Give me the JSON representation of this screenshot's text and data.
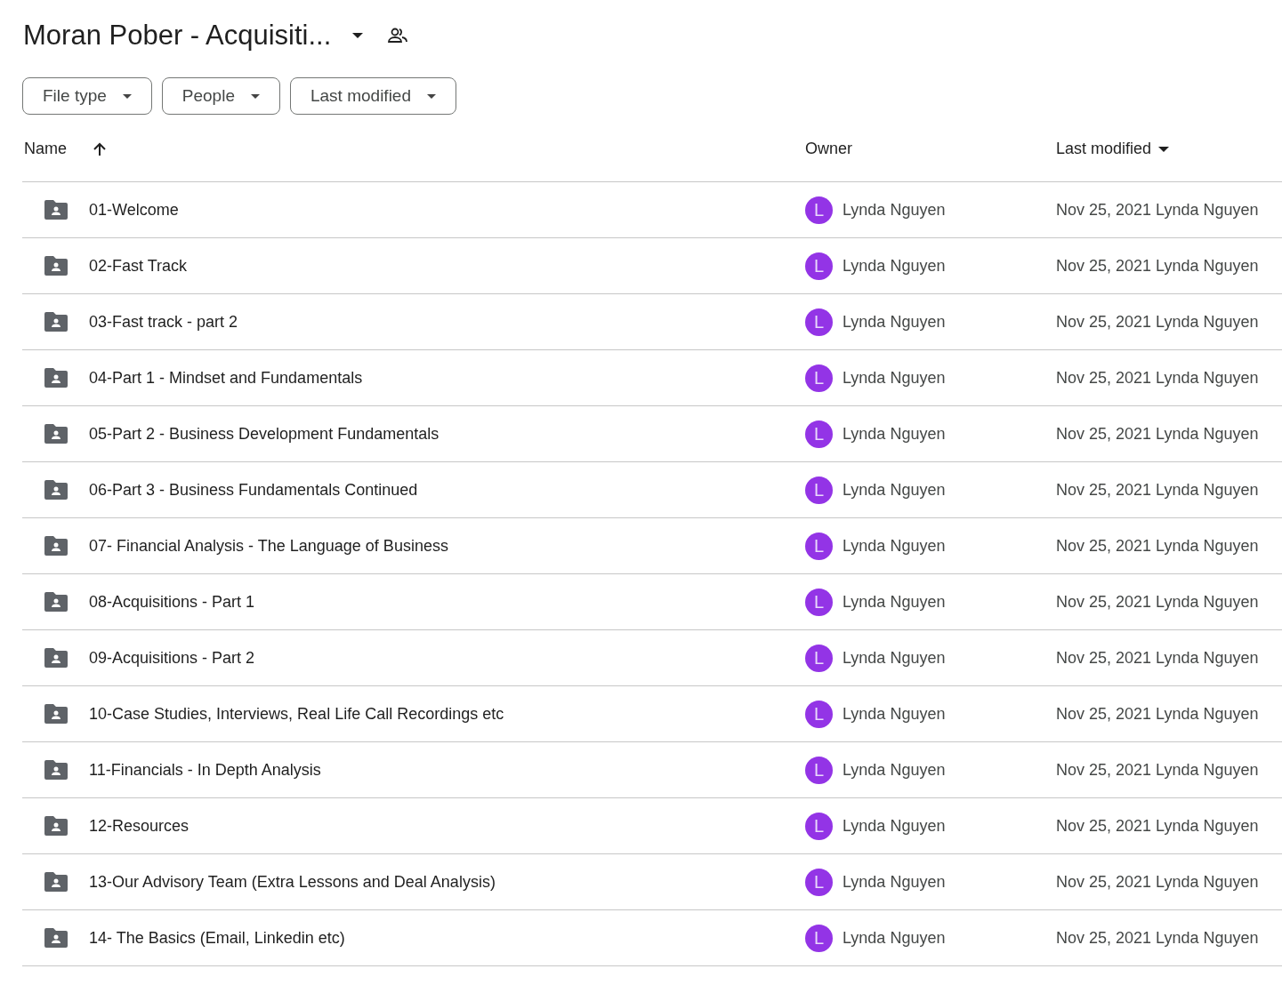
{
  "title": "Moran Pober - Acquisiti...",
  "filters": [
    "File type",
    "People",
    "Last modified"
  ],
  "columns": [
    "Name",
    "Owner",
    "Last modified"
  ],
  "rows": [
    {
      "name": "01-Welcome",
      "avatar": "L",
      "owner": "Lynda Nguyen",
      "modified": "Nov 25, 2021 Lynda Nguyen"
    },
    {
      "name": "02-Fast Track",
      "avatar": "L",
      "owner": "Lynda Nguyen",
      "modified": "Nov 25, 2021 Lynda Nguyen"
    },
    {
      "name": "03-Fast track - part 2",
      "avatar": "L",
      "owner": "Lynda Nguyen",
      "modified": "Nov 25, 2021 Lynda Nguyen"
    },
    {
      "name": "04-Part 1 - Mindset and Fundamentals",
      "avatar": "L",
      "owner": "Lynda Nguyen",
      "modified": "Nov 25, 2021 Lynda Nguyen"
    },
    {
      "name": "05-Part 2 - Business Development Fundamentals",
      "avatar": "L",
      "owner": "Lynda Nguyen",
      "modified": "Nov 25, 2021 Lynda Nguyen"
    },
    {
      "name": "06-Part 3 - Business Fundamentals Continued",
      "avatar": "L",
      "owner": "Lynda Nguyen",
      "modified": "Nov 25, 2021 Lynda Nguyen"
    },
    {
      "name": "07- Financial Analysis - The Language of Business",
      "avatar": "L",
      "owner": "Lynda Nguyen",
      "modified": "Nov 25, 2021 Lynda Nguyen"
    },
    {
      "name": "08-Acquisitions - Part 1",
      "avatar": "L",
      "owner": "Lynda Nguyen",
      "modified": "Nov 25, 2021 Lynda Nguyen"
    },
    {
      "name": "09-Acquisitions - Part 2",
      "avatar": "L",
      "owner": "Lynda Nguyen",
      "modified": "Nov 25, 2021 Lynda Nguyen"
    },
    {
      "name": "10-Case Studies, Interviews, Real Life Call Recordings etc",
      "avatar": "L",
      "owner": "Lynda Nguyen",
      "modified": "Nov 25, 2021 Lynda Nguyen"
    },
    {
      "name": "11-Financials - In Depth Analysis",
      "avatar": "L",
      "owner": "Lynda Nguyen",
      "modified": "Nov 25, 2021 Lynda Nguyen"
    },
    {
      "name": "12-Resources",
      "avatar": "L",
      "owner": "Lynda Nguyen",
      "modified": "Nov 25, 2021 Lynda Nguyen"
    },
    {
      "name": "13-Our Advisory Team (Extra Lessons and Deal Analysis)",
      "avatar": "L",
      "owner": "Lynda Nguyen",
      "modified": "Nov 25, 2021 Lynda Nguyen"
    },
    {
      "name": "14- The Basics (Email, Linkedin etc)",
      "avatar": "L",
      "owner": "Lynda Nguyen",
      "modified": "Nov 25, 2021 Lynda Nguyen"
    }
  ]
}
